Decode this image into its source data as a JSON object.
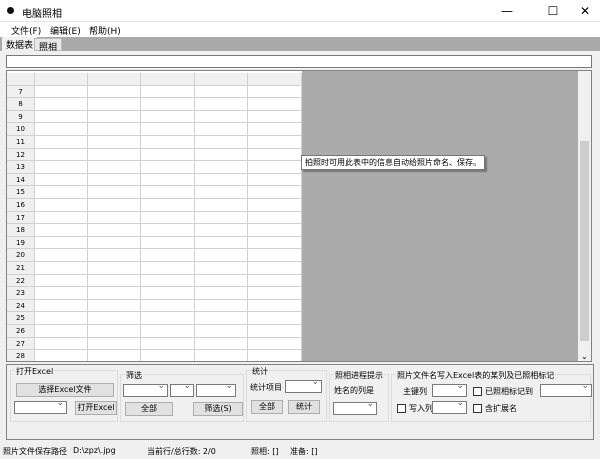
{
  "window": {
    "title": "电脑照相",
    "minimize": "—",
    "maximize": "☐",
    "close": "✕"
  },
  "menu": [
    {
      "label": "文件(F)"
    },
    {
      "label": "编辑(E)"
    },
    {
      "label": "帮助(H)"
    }
  ],
  "tabs": [
    {
      "label": "数据表",
      "selected": true
    },
    {
      "label": "照相",
      "selected": false
    }
  ],
  "grid": {
    "row_numbers": [
      "7",
      "8",
      "9",
      "10",
      "11",
      "12",
      "13",
      "14",
      "15",
      "16",
      "17",
      "18",
      "19",
      "20",
      "21",
      "22",
      "23",
      "24",
      "25",
      "26",
      "27",
      "28"
    ]
  },
  "tooltip": "拍照时可用此表中的信息自动给照片命名、保存。",
  "panel": {
    "open_excel": {
      "title": "打开Excel",
      "choose_button": "选择Excel文件",
      "open_button": "打开Excel"
    },
    "filter": {
      "title": "筛选",
      "all_button": "全部",
      "filter_button": "筛选(S)"
    },
    "stats": {
      "title": "统计",
      "item_label": "统计项目",
      "all_button": "全部",
      "stats_button": "统计"
    },
    "progress": {
      "title": "照相进程提示",
      "name_col_label": "姓名的列是"
    },
    "write": {
      "title": "照片文件名写入Excel表的某列及已照相标记",
      "key_col_label": "主键列",
      "mark_label": "已照相标记到",
      "write_col_label": "写入列",
      "ext_label": "含扩展名"
    }
  },
  "status": {
    "path_label": "照片文件保存路径",
    "path": "D:\\zpz\\.jpg",
    "row_info": "当前行/总行数: 2/0",
    "photo": "照相: []",
    "ready": "准备: []"
  }
}
